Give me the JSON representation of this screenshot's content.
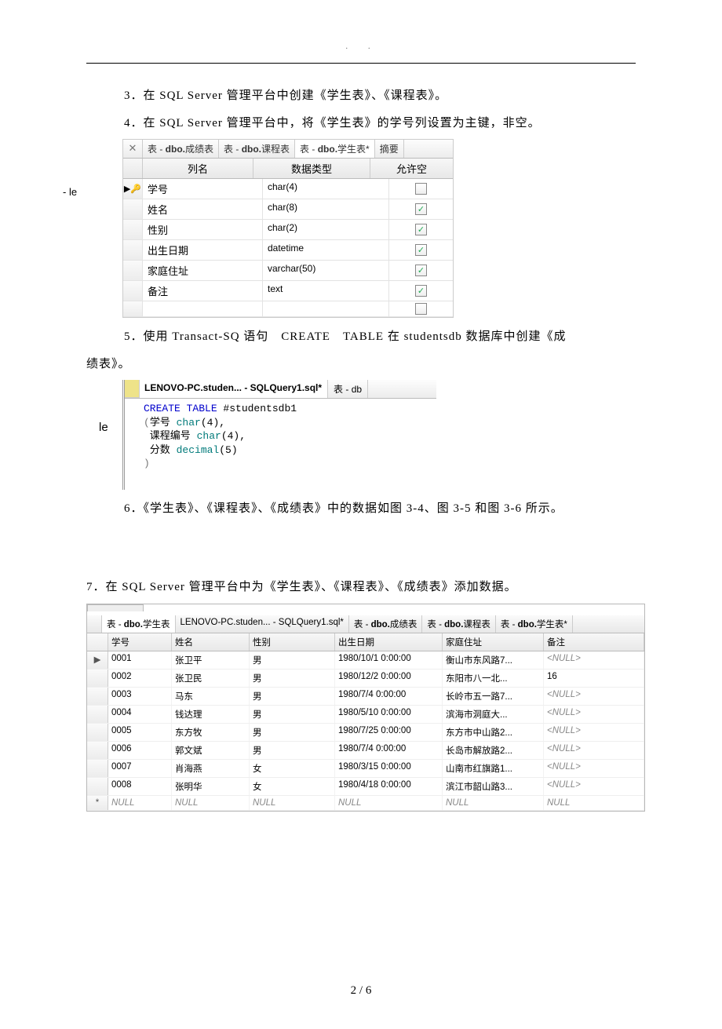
{
  "header_dots": ".　.",
  "paras": {
    "p3": "3．在 SQL Server 管理平台中创建《学生表》、《课程表》。",
    "p4": "4．在 SQL Server 管理平台中，将《学生表》的学号列设置为主键，非空。",
    "p5a": "5．使用 Transact-SQ 语句　CREATE　TABLE 在 studentsdb 数据库中创建《成",
    "p5b": "绩表》。",
    "p6": "6．《学生表》、《课程表》、《成绩表》中的数据如图 3-4、图 3-5 和图 3-6 所示。",
    "p7": "7．在 SQL Server 管理平台中为《学生表》、《课程表》、《成绩表》添加数据。"
  },
  "footer": "2 / 6",
  "designer": {
    "crop_left": "- le",
    "tabs": [
      "表 - dbo.成绩表",
      "表 - dbo.课程表",
      "表 - dbo.学生表*",
      "摘要"
    ],
    "headers": [
      "列名",
      "数据类型",
      "允许空"
    ],
    "rows": [
      {
        "pk": true,
        "name": "学号",
        "type": "char(4)",
        "null": false
      },
      {
        "pk": false,
        "name": "姓名",
        "type": "char(8)",
        "null": true
      },
      {
        "pk": false,
        "name": "性别",
        "type": "char(2)",
        "null": true
      },
      {
        "pk": false,
        "name": "出生日期",
        "type": "datetime",
        "null": true
      },
      {
        "pk": false,
        "name": "家庭住址",
        "type": "varchar(50)",
        "null": true
      },
      {
        "pk": false,
        "name": "备注",
        "type": "text",
        "null": true
      }
    ]
  },
  "sql": {
    "crop_left": "le",
    "tabs": [
      "LENOVO-PC.studen... - SQLQuery1.sql*",
      "表 - db"
    ],
    "code_lines": [
      {
        "t": "CREATE TABLE",
        "cls": "kw",
        "tail": " #studentsdb1"
      },
      {
        "t": "(",
        "cls": "paren",
        "tail": "学号 ",
        "ty": "char",
        "tail2": "(4),"
      },
      {
        "t": " 课程编号 ",
        "cls": "",
        "ty": "char",
        "tail2": "(4),"
      },
      {
        "t": " 分数 ",
        "cls": "",
        "ty": "decimal",
        "tail2": "(5)"
      },
      {
        "t": ")",
        "cls": "paren"
      }
    ]
  },
  "grid": {
    "toptabs": [
      "表 - dbo.学生表",
      "LENOVO-PC.studen... - SQLQuery1.sql*",
      "表 - dbo.成绩表",
      "表 - dbo.课程表",
      "表 - dbo.学生表*"
    ],
    "headers": [
      "学号",
      "姓名",
      "性别",
      "出生日期",
      "家庭住址",
      "备注"
    ],
    "rows": [
      {
        "mk": "▶",
        "c": [
          "0001",
          "张卫平",
          "男",
          "1980/10/1 0:00:00",
          "衡山市东风路7...",
          "<NULL>"
        ]
      },
      {
        "mk": "",
        "c": [
          "0002",
          "张卫民",
          "男",
          "1980/12/2 0:00:00",
          "东阳市八一北...",
          "16"
        ]
      },
      {
        "mk": "",
        "c": [
          "0003",
          "马东",
          "男",
          "1980/7/4 0:00:00",
          "长岭市五一路7...",
          "<NULL>"
        ]
      },
      {
        "mk": "",
        "c": [
          "0004",
          "钱达理",
          "男",
          "1980/5/10 0:00:00",
          "滨海市洞庭大...",
          "<NULL>"
        ]
      },
      {
        "mk": "",
        "c": [
          "0005",
          "东方牧",
          "男",
          "1980/7/25 0:00:00",
          "东方市中山路2...",
          "<NULL>"
        ]
      },
      {
        "mk": "",
        "c": [
          "0006",
          "郭文斌",
          "男",
          "1980/7/4 0:00:00",
          "长岛市解放路2...",
          "<NULL>"
        ]
      },
      {
        "mk": "",
        "c": [
          "0007",
          "肖海燕",
          "女",
          "1980/3/15 0:00:00",
          "山南市红旗路1...",
          "<NULL>"
        ]
      },
      {
        "mk": "",
        "c": [
          "0008",
          "张明华",
          "女",
          "1980/4/18 0:00:00",
          "滨江市韶山路3...",
          "<NULL>"
        ]
      },
      {
        "mk": "*",
        "c": [
          "NULL",
          "NULL",
          "NULL",
          "NULL",
          "NULL",
          "NULL"
        ],
        "null": true
      }
    ]
  }
}
